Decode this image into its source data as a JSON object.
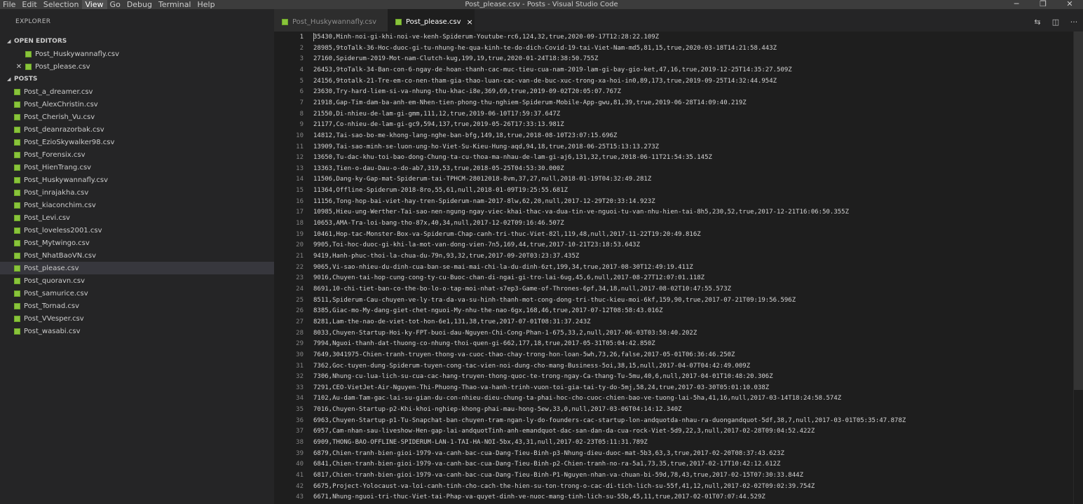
{
  "window": {
    "title": "Post_please.csv - Posts - Visual Studio Code"
  },
  "menu": [
    "File",
    "Edit",
    "Selection",
    "View",
    "Go",
    "Debug",
    "Terminal",
    "Help"
  ],
  "menu_active": "View",
  "window_controls": {
    "minimize": "─",
    "restore": "❐",
    "close": "✕"
  },
  "sidebar": {
    "title": "EXPLORER",
    "open_editors": {
      "label": "OPEN EDITORS",
      "items": [
        "Post_Huskywannafly.csv",
        "Post_please.csv"
      ]
    },
    "folder": {
      "label": "POSTS",
      "items": [
        "Post_a_dreamer.csv",
        "Post_AlexChristin.csv",
        "Post_Cherish_Vu.csv",
        "Post_deanrazorbak.csv",
        "Post_EzioSkywalker98.csv",
        "Post_Forensix.csv",
        "Post_HienTrang.csv",
        "Post_Huskywannafly.csv",
        "Post_inrajakha.csv",
        "Post_kiaconchim.csv",
        "Post_Levi.csv",
        "Post_loveless2001.csv",
        "Post_Mytwingo.csv",
        "Post_NhatBaoVN.csv",
        "Post_please.csv",
        "Post_quoravn.csv",
        "Post_samurice.csv",
        "Post_Tornad.csv",
        "Post_VVesper.csv",
        "Post_wasabi.csv"
      ]
    },
    "selected_file": "Post_please.csv"
  },
  "tabs": [
    {
      "label": "Post_Huskywannafly.csv",
      "active": false
    },
    {
      "label": "Post_please.csv",
      "active": true,
      "close": "×"
    }
  ],
  "editor_actions": {
    "compare": "⇆",
    "split": "◫",
    "more": "···"
  },
  "editor": {
    "current_line": 1,
    "lines": [
      "35430,Minh-noi-gi-khi-noi-ve-kenh-Spiderum-Youtube-rc6,124,32,true,2020-09-17T12:28:22.109Z",
      "28985,9toTalk-36-Hoc-duoc-gi-tu-nhung-he-qua-kinh-te-do-dich-Covid-19-tai-Viet-Nam-md5,81,15,true,2020-03-18T14:21:58.443Z",
      "27160,Spiderum-2019-Mot-nam-Clutch-kug,199,19,true,2020-01-24T18:38:50.755Z",
      "26453,9toTalk-34-Ban-con-6-ngay-de-hoan-thanh-cac-muc-tieu-cua-nam-2019-lam-gi-bay-gio-ket,47,16,true,2019-12-25T14:35:27.509Z",
      "24156,9totalk-21-Tre-em-co-nen-tham-gia-thao-luan-cac-van-de-buc-xuc-trong-xa-hoi-in0,89,173,true,2019-09-25T14:32:44.954Z",
      "23630,Try-hard-liem-si-va-nhung-thu-khac-i8e,369,69,true,2019-09-02T20:05:07.767Z",
      "21918,Gap-Tim-dam-ba-anh-em-Nhen-tien-phong-thu-nghiem-Spiderum-Mobile-App-gwu,81,39,true,2019-06-28T14:09:40.219Z",
      "21550,Di-nhieu-de-lam-gi-gmm,111,12,true,2019-06-10T17:59:37.647Z",
      "21177,Co-nhieu-de-lam-gi-gc9,594,137,true,2019-05-26T17:33:13.981Z",
      "14812,Tai-sao-bo-me-khong-lang-nghe-ban-bfg,149,18,true,2018-08-10T23:07:15.696Z",
      "13909,Tai-sao-minh-se-luon-ung-ho-Viet-Su-Kieu-Hung-aqd,94,18,true,2018-06-25T15:13:13.273Z",
      "13650,Tu-dac-khu-toi-bao-dong-Chung-ta-cu-thoa-ma-nhau-de-lam-gi-aj6,131,32,true,2018-06-11T21:54:35.145Z",
      "13363,Tien-o-dau-Dau-o-do-ab7,319,53,true,2018-05-25T04:53:30.000Z",
      "11506,Dang-ky-Gap-mat-Spiderum-tai-TPHCM-28012018-8vm,37,27,null,2018-01-19T04:32:49.281Z",
      "11364,Offline-Spiderum-2018-8ro,55,61,null,2018-01-09T19:25:55.681Z",
      "11156,Tong-hop-bai-viet-hay-tren-Spiderum-nam-2017-8lw,62,20,null,2017-12-29T20:33:14.923Z",
      "10985,Hieu-ung-Werther-Tai-sao-nen-ngung-ngay-viec-khai-thac-va-dua-tin-ve-nguoi-tu-van-nhu-hien-tai-8h5,230,52,true,2017-12-21T16:06:50.355Z",
      "10653,AMA-Tra-loi-bang-tho-87x,40,34,null,2017-12-02T09:16:46.507Z",
      "10461,Hop-tac-Monster-Box-va-Spiderum-Chap-canh-tri-thuc-Viet-82l,119,48,null,2017-11-22T19:20:49.816Z",
      "9905,Toi-hoc-duoc-gi-khi-la-mot-van-dong-vien-7n5,169,44,true,2017-10-21T23:18:53.643Z",
      "9419,Hanh-phuc-thoi-la-chua-du-79n,93,32,true,2017-09-20T03:23:37.435Z",
      "9065,Vi-sao-nhieu-du-dinh-cua-ban-se-mai-mai-chi-la-du-dinh-6zt,199,34,true,2017-08-30T12:49:19.411Z",
      "9016,Chuyen-tai-hop-cung-cong-ty-cu-Buoc-chan-di-ngai-gi-tro-lai-6ug,45,6,null,2017-08-27T12:07:01.118Z",
      "8691,10-chi-tiet-ban-co-the-bo-lo-o-tap-moi-nhat-s7ep3-Game-of-Thrones-6pf,34,18,null,2017-08-02T10:47:55.573Z",
      "8511,Spiderum-Cau-chuyen-ve-ly-tra-da-va-su-hinh-thanh-mot-cong-dong-tri-thuc-kieu-moi-6kf,159,90,true,2017-07-21T09:19:56.596Z",
      "8385,Giac-mo-My-dang-giet-chet-nguoi-My-nhu-the-nao-6gx,168,46,true,2017-07-12T08:58:43.016Z",
      "8281,Lam-the-nao-de-viet-tot-hon-6e1,131,38,true,2017-07-01T08:31:37.243Z",
      "8033,Chuyen-Startup-Hoi-ky-FPT-buoi-dau-Nguyen-Chi-Cong-Phan-1-675,33,2,null,2017-06-03T03:58:40.202Z",
      "7994,Nguoi-thanh-dat-thuong-co-nhung-thoi-quen-gi-662,177,18,true,2017-05-31T05:04:42.850Z",
      "7649,3041975-Chien-tranh-truyen-thong-va-cuoc-thao-chay-trong-hon-loan-5wh,73,26,false,2017-05-01T06:36:46.250Z",
      "7362,Goc-tuyen-dung-Spiderum-tuyen-cong-tac-vien-noi-dung-cho-mang-Business-5oi,38,15,null,2017-04-07T04:42:49.009Z",
      "7306,Nhung-cu-lua-lich-su-cua-cac-hang-truyen-thong-quoc-te-trong-ngay-Ca-thang-Tu-5mu,40,6,null,2017-04-01T10:48:20.306Z",
      "7291,CEO-VietJet-Air-Nguyen-Thi-Phuong-Thao-va-hanh-trinh-vuon-toi-gia-tai-ty-do-5mj,58,24,true,2017-03-30T05:01:10.038Z",
      "7102,Au-dam-Tam-gac-lai-su-gian-du-con-nhieu-dieu-chung-ta-phai-hoc-cho-cuoc-chien-bao-ve-tuong-lai-5ha,41,16,null,2017-03-14T18:24:58.574Z",
      "7016,Chuyen-Startup-p2-Khi-khoi-nghiep-khong-phai-mau-hong-5ew,33,0,null,2017-03-06T04:14:12.340Z",
      "6963,Chuyen-Startup-p1-Tu-Snapchat-ban-chuyen-tram-ngan-ly-do-founders-cac-startup-lon-andquotda-nhau-ra-duongandquot-5df,38,7,null,2017-03-01T05:35:47.878Z",
      "6957,Cam-nhan-sau-liveshow-Hen-gap-lai-andquotTinh-anh-emandquot-dac-san-dan-da-cua-rock-Viet-5d9,22,3,null,2017-02-28T09:04:52.422Z",
      "6909,THONG-BAO-OFFLINE-SPIDERUM-LAN-1-TAI-HA-NOI-5bx,43,31,null,2017-02-23T05:11:31.789Z",
      "6879,Chien-tranh-bien-gioi-1979-va-canh-bac-cua-Dang-Tieu-Binh-p3-Nhung-dieu-duoc-mat-5b3,63,3,true,2017-02-20T08:37:43.623Z",
      "6841,Chien-tranh-bien-gioi-1979-va-canh-bac-cua-Dang-Tieu-Binh-p2-Chien-tranh-no-ra-5a1,73,35,true,2017-02-17T10:42:12.612Z",
      "6817,Chien-tranh-bien-gioi-1979-va-canh-bac-cua-Dang-Tieu-Binh-P1-Nguyen-nhan-va-chuan-bi-59d,78,43,true,2017-02-15T07:30:33.844Z",
      "6675,Project-Yolocaust-va-loi-canh-tinh-cho-cach-the-hien-su-ton-trong-o-cac-di-tich-lich-su-55f,41,12,null,2017-02-02T09:02:39.754Z",
      "6671,Nhung-nguoi-tri-thuc-Viet-tai-Phap-va-quyet-dinh-ve-nuoc-mang-tinh-lich-su-55b,45,11,true,2017-02-01T07:07:44.529Z"
    ]
  }
}
